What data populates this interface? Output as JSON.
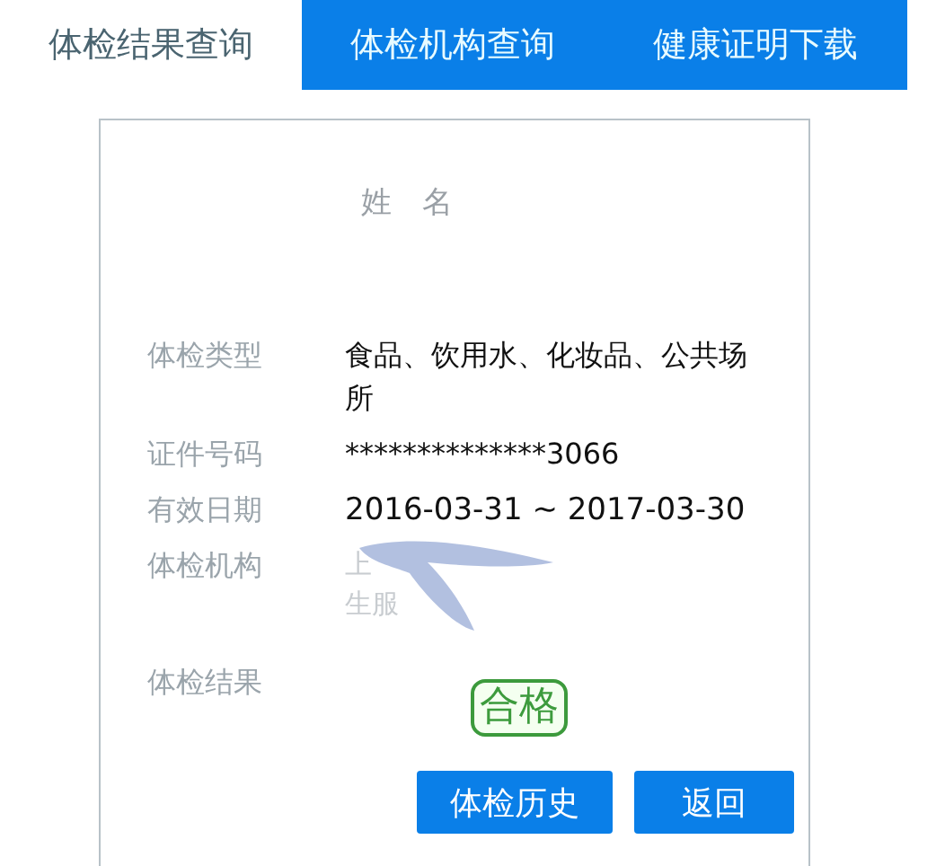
{
  "tabs": [
    {
      "label": "体检结果查询",
      "selected": true
    },
    {
      "label": "体检机构查询",
      "selected": false
    },
    {
      "label": "健康证明下载",
      "selected": false
    }
  ],
  "card": {
    "name": "姓　名",
    "fields": [
      {
        "label": "体检类型",
        "kind": "text",
        "value": "食品、饮用水、化妆品、公共场所"
      },
      {
        "label": "证件号码",
        "kind": "text",
        "value": "**************3066"
      },
      {
        "label": "有效日期",
        "kind": "text",
        "value": "2016-03-31 ~ 2017-03-30"
      },
      {
        "label": "体检机构",
        "kind": "redacted",
        "lines": [
          "上",
          "生服"
        ]
      },
      {
        "label": "体检结果",
        "kind": "badge",
        "value": "合格"
      }
    ],
    "buttons": [
      "体检历史",
      "返回"
    ]
  }
}
